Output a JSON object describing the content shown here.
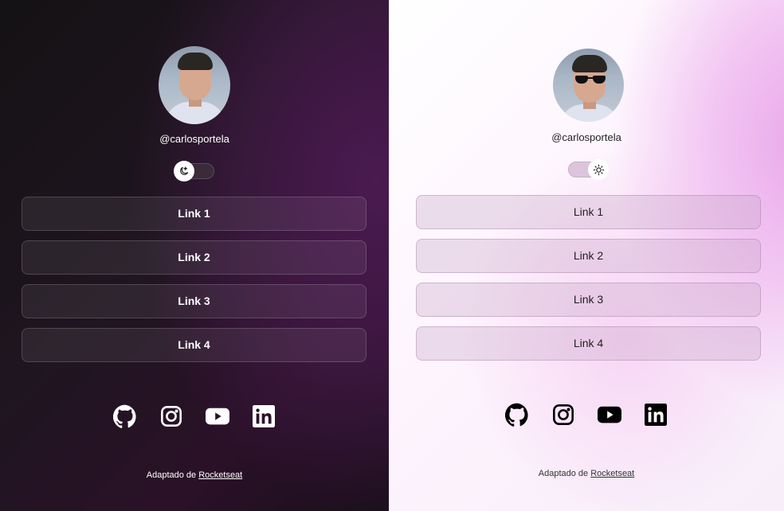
{
  "dark_panel": {
    "theme": "dark",
    "username": "@carlosportela",
    "toggle_icon": "moon-icon",
    "links": [
      {
        "label": "Link 1"
      },
      {
        "label": "Link 2"
      },
      {
        "label": "Link 3"
      },
      {
        "label": "Link 4"
      }
    ],
    "socials": [
      "github-icon",
      "instagram-icon",
      "youtube-icon",
      "linkedin-icon"
    ],
    "footer": {
      "prefix": "Adaptado de ",
      "link": "Rocketseat"
    }
  },
  "light_panel": {
    "theme": "light",
    "username": "@carlosportela",
    "toggle_icon": "sun-icon",
    "links": [
      {
        "label": "Link 1"
      },
      {
        "label": "Link 2"
      },
      {
        "label": "Link 3"
      },
      {
        "label": "Link 4"
      }
    ],
    "socials": [
      "github-icon",
      "instagram-icon",
      "youtube-icon",
      "linkedin-icon"
    ],
    "footer": {
      "prefix": "Adaptado de ",
      "link": "Rocketseat"
    }
  },
  "colors": {
    "dark_bg": "#1f1520",
    "dark_accent": "#4a1a50",
    "light_bg": "#fdf3fd",
    "light_accent": "#e9a8ea"
  }
}
